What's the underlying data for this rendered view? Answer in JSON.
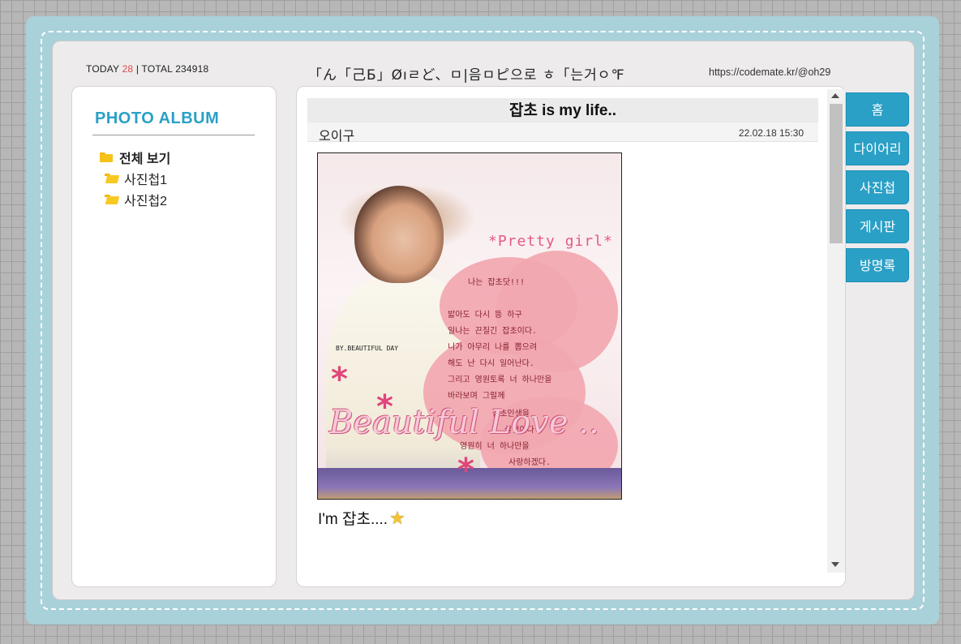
{
  "counter": {
    "today_label": "TODAY",
    "today_value": "28",
    "separator": "|",
    "total_label": "TOTAL",
    "total_value": "234918"
  },
  "header": {
    "title": "「ん「己Ƃ」Øıㄹど、ㅁ|음ㅁピ으로 ㅎ「는거ㅇ℉",
    "url": "https://codemate.kr/@oh29"
  },
  "album": {
    "title": "PHOTO ALBUM",
    "folders": [
      {
        "label": "전체 보기",
        "icon": "folder-icon"
      },
      {
        "label": "사진첩1",
        "icon": "folder-open-icon"
      },
      {
        "label": "사진첩2",
        "icon": "folder-open-icon"
      }
    ]
  },
  "post": {
    "title": "잡초 is my life..",
    "author": "오이구",
    "date": "22.02.18 15:30",
    "caption": "I'm 잡초....",
    "caption_icon": "star-icon",
    "image": {
      "pretty_text": "*Pretty girl*",
      "by_text": "BY.BEAUTIFUL DAY",
      "script_text": "Beautiful Love ..",
      "poem": [
        "나는 잡초닷!!!",
        "밟아도 다시 뜽 하구",
        "일나는 끈질긴 잡초이다.",
        "니가 아무리 나를 뽑으려",
        "해도 난 다시 일어난다.",
        "그리고 영원토록 너 하나만을",
        "바라보며 그럴께",
        "잡초인생을",
        "살것이다!!",
        "영원히 너 하나만을",
        "사랑하겠다."
      ]
    }
  },
  "nav": [
    "홈",
    "다이어리",
    "사진첩",
    "게시판",
    "방명록"
  ],
  "colors": {
    "accent": "#2aa0c6",
    "frame": "#a9d1da",
    "today": "#e04848"
  }
}
